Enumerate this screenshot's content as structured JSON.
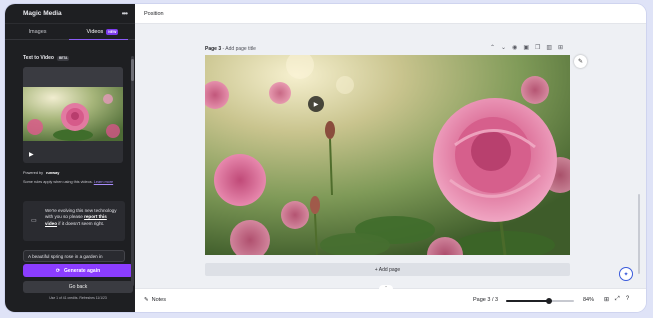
{
  "panel": {
    "title": "Magic Media",
    "tabs": [
      {
        "label": "Images",
        "active": false
      },
      {
        "label": "Videos",
        "active": true,
        "badge": "NEW"
      }
    ],
    "section_title": "Text to Video",
    "section_badge": "BETA",
    "powered_by_label": "Powered by",
    "powered_by_brand": "runway",
    "rules_text": "Some rules apply when using this videos.",
    "rules_link": "Learn more",
    "notice_pre": "We're evolving this new technology with you so please",
    "notice_link": "report this video",
    "notice_post": "if it doesn't seem right.",
    "prompt_value": "A beautiful spring rose in a garden in",
    "generate_again_label": "Generate again",
    "go_back_label": "Go back",
    "credits_text": "Use 1 of 41 credits. Refreshes 11/1/23"
  },
  "toolbar": {
    "position_label": "Position"
  },
  "page": {
    "label": "Page 3",
    "title_placeholder": "- Add page title",
    "tools": [
      "chevron-up-icon",
      "chevron-down-icon",
      "eye-icon",
      "lock-icon",
      "duplicate-icon",
      "trash-icon",
      "add-page-icon"
    ]
  },
  "add_page_label": "+ Add page",
  "footer": {
    "notes_label": "Notes",
    "page_count": "Page 3 / 3",
    "zoom_level": "84%",
    "zoom_fraction": 0.63
  },
  "colors": {
    "accent": "#8b3dff",
    "panel_bg": "#1e1f22",
    "canvas_bg": "#eef0f4"
  }
}
